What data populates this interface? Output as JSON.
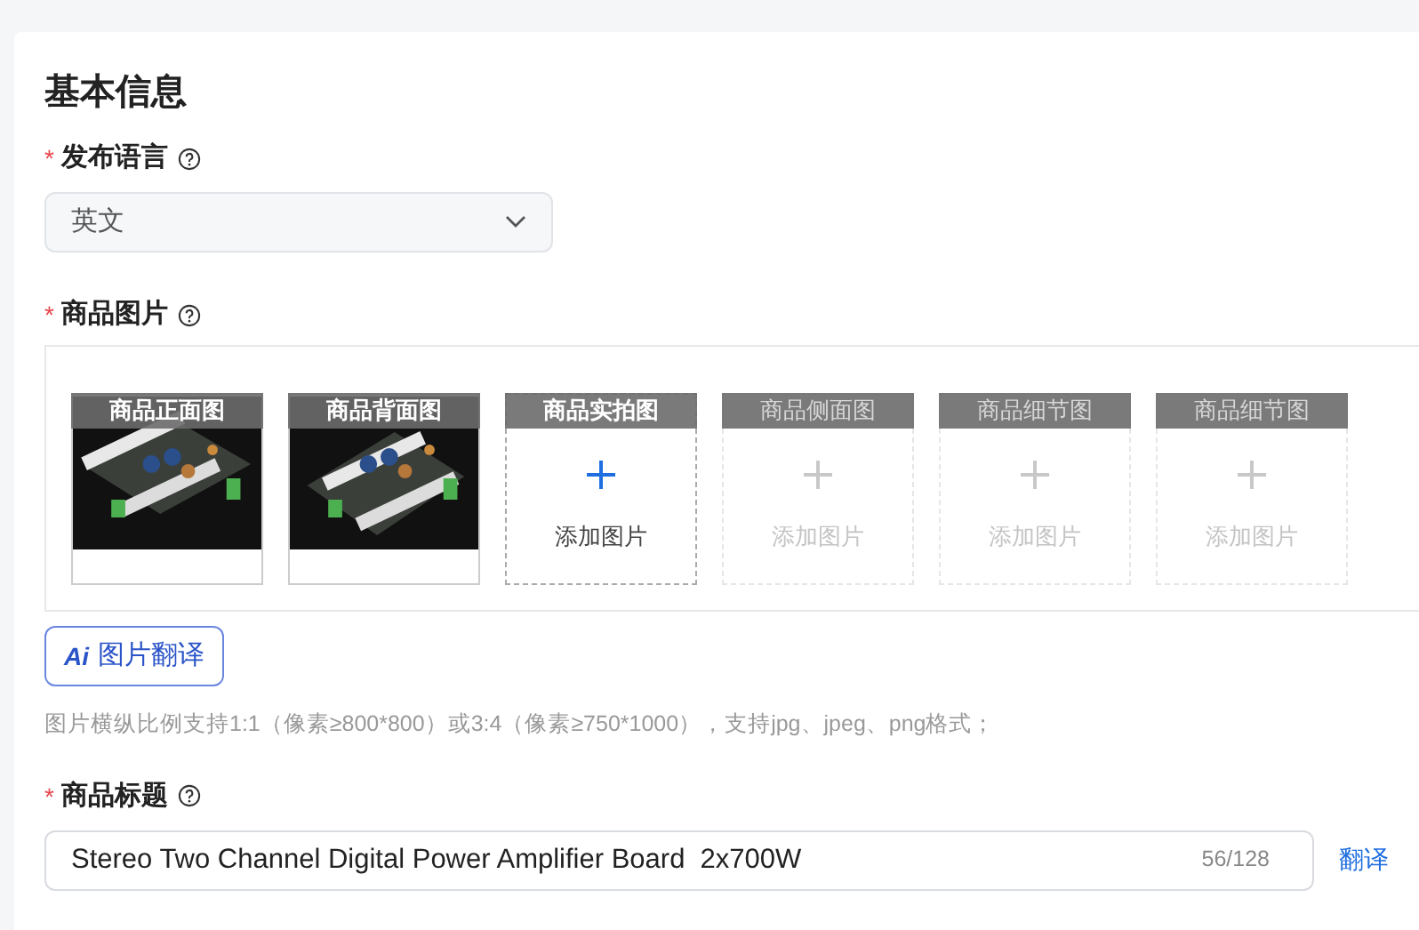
{
  "section_title": "基本信息",
  "language": {
    "label": "发布语言",
    "required_mark": "*",
    "value": "英文"
  },
  "images": {
    "label": "商品图片",
    "required_mark": "*",
    "slots": [
      {
        "caption": "商品正面图",
        "kind": "picture",
        "disabled": false
      },
      {
        "caption": "商品背面图",
        "kind": "picture",
        "disabled": false
      },
      {
        "caption": "商品实拍图",
        "kind": "empty",
        "add_label": "添加图片",
        "disabled": false
      },
      {
        "caption": "商品侧面图",
        "kind": "empty",
        "add_label": "添加图片",
        "disabled": true
      },
      {
        "caption": "商品细节图",
        "kind": "empty",
        "add_label": "添加图片",
        "disabled": true
      },
      {
        "caption": "商品细节图",
        "kind": "empty",
        "add_label": "添加图片",
        "disabled": true
      }
    ],
    "translate_button": {
      "icon_text": "Ai",
      "label": "图片翻译"
    },
    "hint": "图片横纵比例支持1:1（像素≥800*800）或3:4（像素≥750*1000），支持jpg、jpeg、png格式；"
  },
  "title": {
    "label": "商品标题",
    "required_mark": "*",
    "value": "Stereo Two Channel Digital Power Amplifier Board  2x700W",
    "count": "56/128",
    "translate_link": "翻译"
  }
}
